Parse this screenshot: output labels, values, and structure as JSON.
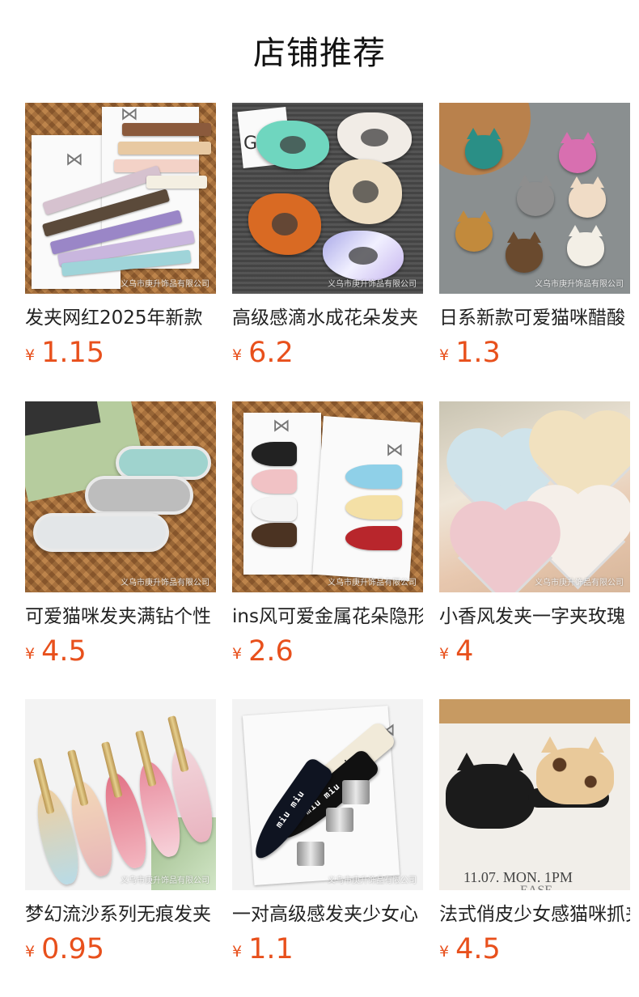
{
  "header": {
    "title": "店铺推荐"
  },
  "currency_symbol": "¥",
  "watermark": "义乌市庚升饰品有限公司",
  "colors": {
    "price": "#e8501c",
    "title": "#111111"
  },
  "products": [
    {
      "name": "发夹网红2025年新款",
      "price": "1.15"
    },
    {
      "name": "高级感滴水成花朵发夹",
      "price": "6.2"
    },
    {
      "name": "日系新款可爱猫咪醋酸",
      "price": "1.3"
    },
    {
      "name": "可爱猫咪发夹满钻个性",
      "price": "4.5"
    },
    {
      "name": "ins风可爱金属花朵隐形",
      "price": "2.6"
    },
    {
      "name": "小香风发夹一字夹玫瑰",
      "price": "4"
    },
    {
      "name": "梦幻流沙系列无痕发夹",
      "price": "0.95"
    },
    {
      "name": "一对高级感发夹少女心",
      "price": "1.1"
    },
    {
      "name": "法式俏皮少女感猫咪抓夹",
      "price": "4.5"
    }
  ],
  "image_text": {
    "card_tag": "G",
    "miu_label": "miu miu",
    "photo_caption": "11.07. MON. 1PM",
    "photo_caption_2": "EASE"
  }
}
